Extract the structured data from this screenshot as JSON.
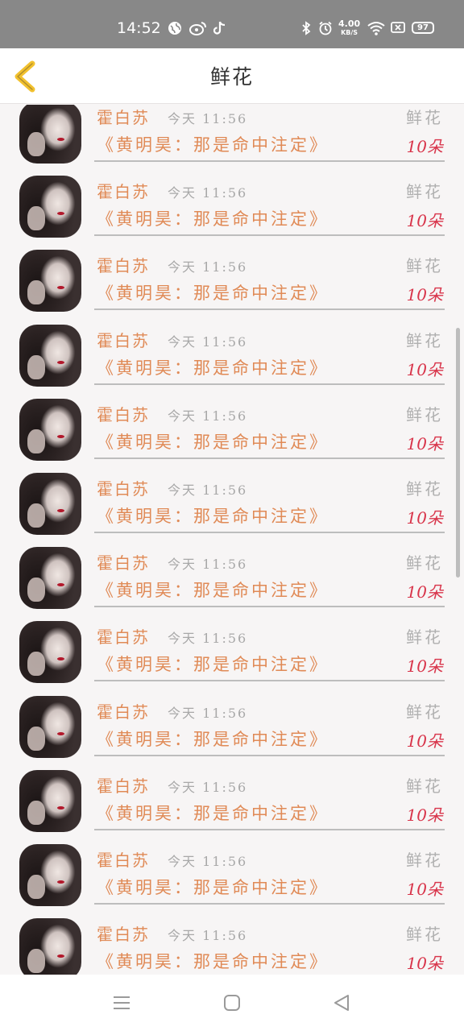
{
  "status_bar": {
    "time": "14:52",
    "speed_value": "4.00",
    "speed_unit": "KB/S",
    "battery": "97"
  },
  "header": {
    "title": "鲜花"
  },
  "records": [
    {
      "sender": "霍白苏",
      "time": "今天 11:56",
      "gift": "鲜花",
      "book": "《黄明昊：那是命中注定》",
      "count": "10朵"
    },
    {
      "sender": "霍白苏",
      "time": "今天 11:56",
      "gift": "鲜花",
      "book": "《黄明昊：那是命中注定》",
      "count": "10朵"
    },
    {
      "sender": "霍白苏",
      "time": "今天 11:56",
      "gift": "鲜花",
      "book": "《黄明昊：那是命中注定》",
      "count": "10朵"
    },
    {
      "sender": "霍白苏",
      "time": "今天 11:56",
      "gift": "鲜花",
      "book": "《黄明昊：那是命中注定》",
      "count": "10朵"
    },
    {
      "sender": "霍白苏",
      "time": "今天 11:56",
      "gift": "鲜花",
      "book": "《黄明昊：那是命中注定》",
      "count": "10朵"
    },
    {
      "sender": "霍白苏",
      "time": "今天 11:56",
      "gift": "鲜花",
      "book": "《黄明昊：那是命中注定》",
      "count": "10朵"
    },
    {
      "sender": "霍白苏",
      "time": "今天 11:56",
      "gift": "鲜花",
      "book": "《黄明昊：那是命中注定》",
      "count": "10朵"
    },
    {
      "sender": "霍白苏",
      "time": "今天 11:56",
      "gift": "鲜花",
      "book": "《黄明昊：那是命中注定》",
      "count": "10朵"
    },
    {
      "sender": "霍白苏",
      "time": "今天 11:56",
      "gift": "鲜花",
      "book": "《黄明昊：那是命中注定》",
      "count": "10朵"
    },
    {
      "sender": "霍白苏",
      "time": "今天 11:56",
      "gift": "鲜花",
      "book": "《黄明昊：那是命中注定》",
      "count": "10朵"
    },
    {
      "sender": "霍白苏",
      "time": "今天 11:56",
      "gift": "鲜花",
      "book": "《黄明昊：那是命中注定》",
      "count": "10朵"
    },
    {
      "sender": "霍白苏",
      "time": "今天 11:56",
      "gift": "鲜花",
      "book": "《黄明昊：那是命中注定》",
      "count": "10朵"
    }
  ],
  "colors": {
    "accent": "#e08a56",
    "count": "#d8344a",
    "back_arrow": "#f2c12e",
    "status_bar": "#888888"
  },
  "icons": {
    "back": "chevron-left-icon",
    "nav_menu": "menu-icon",
    "nav_home": "home-icon",
    "nav_back": "back-triangle-icon"
  }
}
